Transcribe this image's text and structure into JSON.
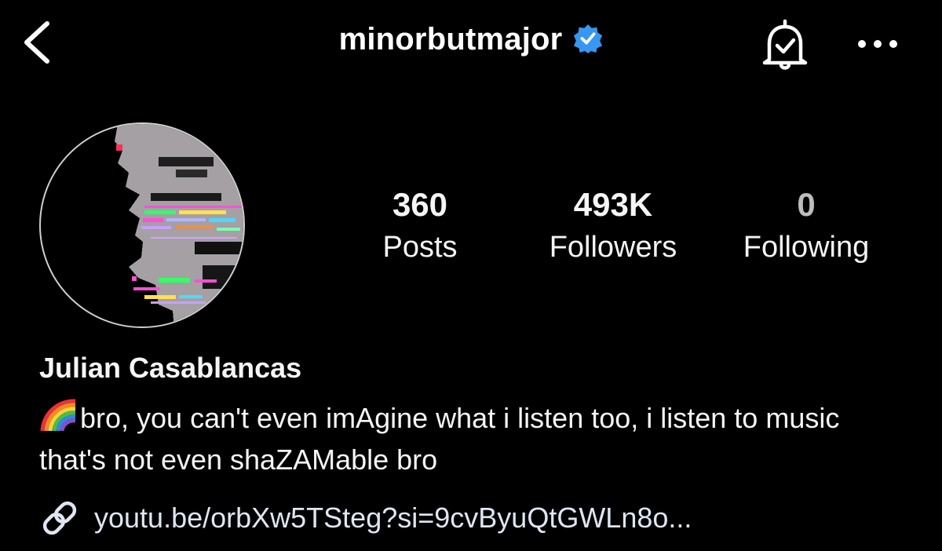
{
  "header": {
    "username": "minorbutmajor",
    "icons": {
      "back": "chevron-left-icon",
      "verified": "verified-badge-icon",
      "notifications": "bell-check-icon",
      "more": "more-horizontal-icon"
    },
    "colors": {
      "verified_badge": "#3897f0"
    }
  },
  "profile": {
    "stats": [
      {
        "value": "360",
        "label": "Posts"
      },
      {
        "value": "493K",
        "label": "Followers"
      },
      {
        "value": "0",
        "label": "Following"
      }
    ],
    "display_name": "Julian Casablancas",
    "bio_emoji": "rainbow-emoji",
    "bio": "bro, you can't even imAgine what i listen too, i listen to music that's not even shaZAMable bro",
    "link": {
      "icon": "link-icon",
      "text": "youtu.be/orbXw5TSteg?si=9cvByuQtGWLn8o..."
    }
  }
}
